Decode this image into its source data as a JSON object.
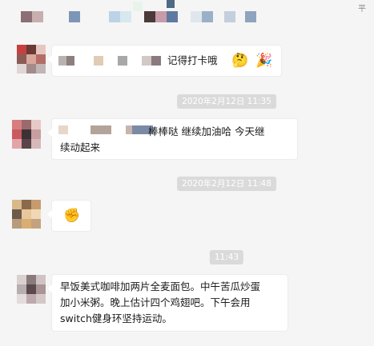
{
  "window": {
    "pin_label": "平"
  },
  "messages": [
    {
      "text": "记得打卡哦",
      "emojis": [
        "🤔",
        "🎉"
      ]
    },
    {
      "timestamp": "2020年2月12日 11:35",
      "line1": "棒棒哒   继续加油哈   今天继",
      "line2": "续动起来"
    },
    {
      "timestamp": "2020年2月12日 11:48",
      "emoji": "✊"
    },
    {
      "timestamp": "11:43",
      "line1": "早饭美式咖啡加两片全麦面包。中午苦瓜炒蛋",
      "line2": "加小米粥。晚上估计四个鸡翅吧。下午会用",
      "line3": "switch健身环坚持运动。"
    }
  ]
}
